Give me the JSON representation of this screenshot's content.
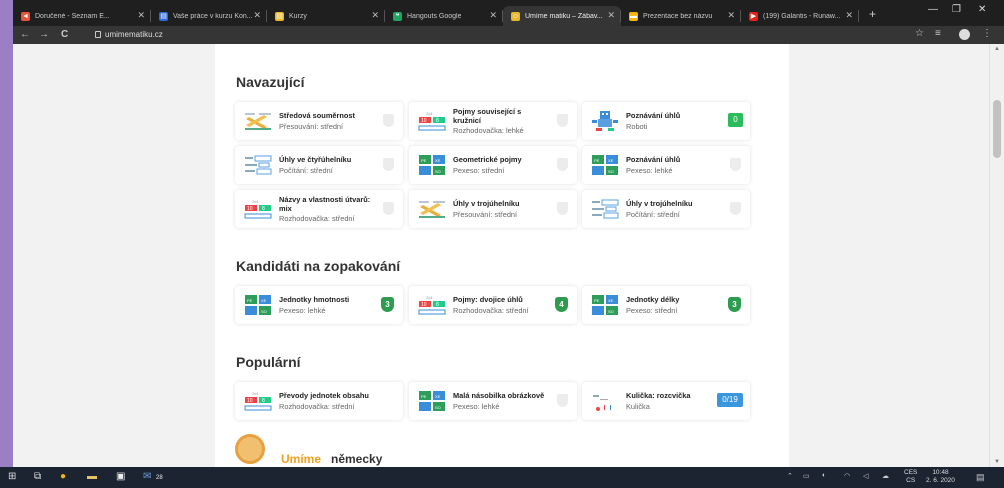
{
  "browser": {
    "tabs": [
      {
        "title": "Doručené - Seznam E...",
        "color": "#e9513a",
        "glyph": "◄",
        "active": false
      },
      {
        "title": "Vaše práce v kurzu Kon...",
        "color": "#2d6cd6",
        "glyph": "▤",
        "active": false
      },
      {
        "title": "Kurzy",
        "color": "#e8b82a",
        "glyph": "▤",
        "active": false
      },
      {
        "title": "Hangouts Google",
        "color": "#1fa463",
        "glyph": "❝",
        "active": false
      },
      {
        "title": "Umíme matiku – Zábav...",
        "color": "#e8b82a",
        "glyph": "☺",
        "active": true
      },
      {
        "title": "Prezentace bez názvu",
        "color": "#f2b705",
        "glyph": "▬",
        "active": false
      },
      {
        "title": "(199) Galantis - Runaw...",
        "color": "#e62117",
        "glyph": "▶",
        "active": false
      }
    ],
    "url": "umimematiku.cz",
    "controls": {
      "back": "←",
      "forward": "→",
      "reload": "C",
      "star": "☆",
      "menu": "⋮",
      "newtab": "+",
      "minimize": "—",
      "maximize": "❐",
      "close": "✕"
    }
  },
  "sections": [
    {
      "title": "Navazující",
      "cards": [
        {
          "title": "Středová souměrnost",
          "subtitle": "Přesouvání: střední",
          "icon": "move-icon",
          "badge": {
            "type": "shield"
          }
        },
        {
          "title": "Pojmy související s kružnicí",
          "subtitle": "Rozhodovačka: lehké",
          "icon": "decide-icon",
          "badge": {
            "type": "shield"
          }
        },
        {
          "title": "Poznávání úhlů",
          "subtitle": "Roboti",
          "icon": "robot-icon",
          "badge": {
            "type": "score",
            "value": "0",
            "color": "green"
          }
        },
        {
          "title": "Úhly ve čtyřúhelníku",
          "subtitle": "Počítání: střední",
          "icon": "count-icon",
          "badge": {
            "type": "shield"
          }
        },
        {
          "title": "Geometrické pojmy",
          "subtitle": "Pexeso: střední",
          "icon": "pexeso-icon",
          "badge": {
            "type": "shield"
          }
        },
        {
          "title": "Poznávání úhlů",
          "subtitle": "Pexeso: lehké",
          "icon": "pexeso-icon",
          "badge": {
            "type": "shield"
          }
        },
        {
          "title": "Názvy a vlastnosti útvarů: mix",
          "subtitle": "Rozhodovačka: střední",
          "icon": "decide-icon",
          "badge": {
            "type": "shield"
          }
        },
        {
          "title": "Úhly v trojúhelníku",
          "subtitle": "Přesouvání: střední",
          "icon": "move-icon",
          "badge": {
            "type": "shield"
          }
        },
        {
          "title": "Úhly v trojúhelníku",
          "subtitle": "Počítání: střední",
          "icon": "count-icon",
          "badge": {
            "type": "shield"
          }
        }
      ]
    },
    {
      "title": "Kandidáti na zopakování",
      "cards": [
        {
          "title": "Jednotky hmotnosti",
          "subtitle": "Pexeso: lehké",
          "icon": "pexeso-icon",
          "badge": {
            "type": "hex",
            "value": "3"
          }
        },
        {
          "title": "Pojmy: dvojice úhlů",
          "subtitle": "Rozhodovačka: střední",
          "icon": "decide-icon",
          "badge": {
            "type": "hex",
            "value": "4"
          }
        },
        {
          "title": "Jednotky délky",
          "subtitle": "Pexeso: střední",
          "icon": "pexeso-icon",
          "badge": {
            "type": "hex",
            "value": "3"
          }
        }
      ]
    },
    {
      "title": "Populární",
      "cards": [
        {
          "title": "Převody jednotek obsahu",
          "subtitle": "Rozhodovačka: střední",
          "icon": "decide-icon",
          "badge": {
            "type": "none"
          }
        },
        {
          "title": "Malá násobilka obrázkově",
          "subtitle": "Pexeso: lehké",
          "icon": "pexeso-icon",
          "badge": {
            "type": "shield"
          }
        },
        {
          "title": "Kulička: rozcvička",
          "subtitle": "Kulička",
          "icon": "ball-icon",
          "badge": {
            "type": "score",
            "value": "0/19",
            "color": "blue"
          }
        }
      ]
    }
  ],
  "promo": {
    "highlight": "Umíme",
    "text": "německy"
  },
  "taskbar": {
    "badge": "28",
    "lang": {
      "line1": "CES",
      "line2": "CS"
    },
    "clock": {
      "time": "10:48",
      "date": "2. 6. 2020"
    }
  }
}
